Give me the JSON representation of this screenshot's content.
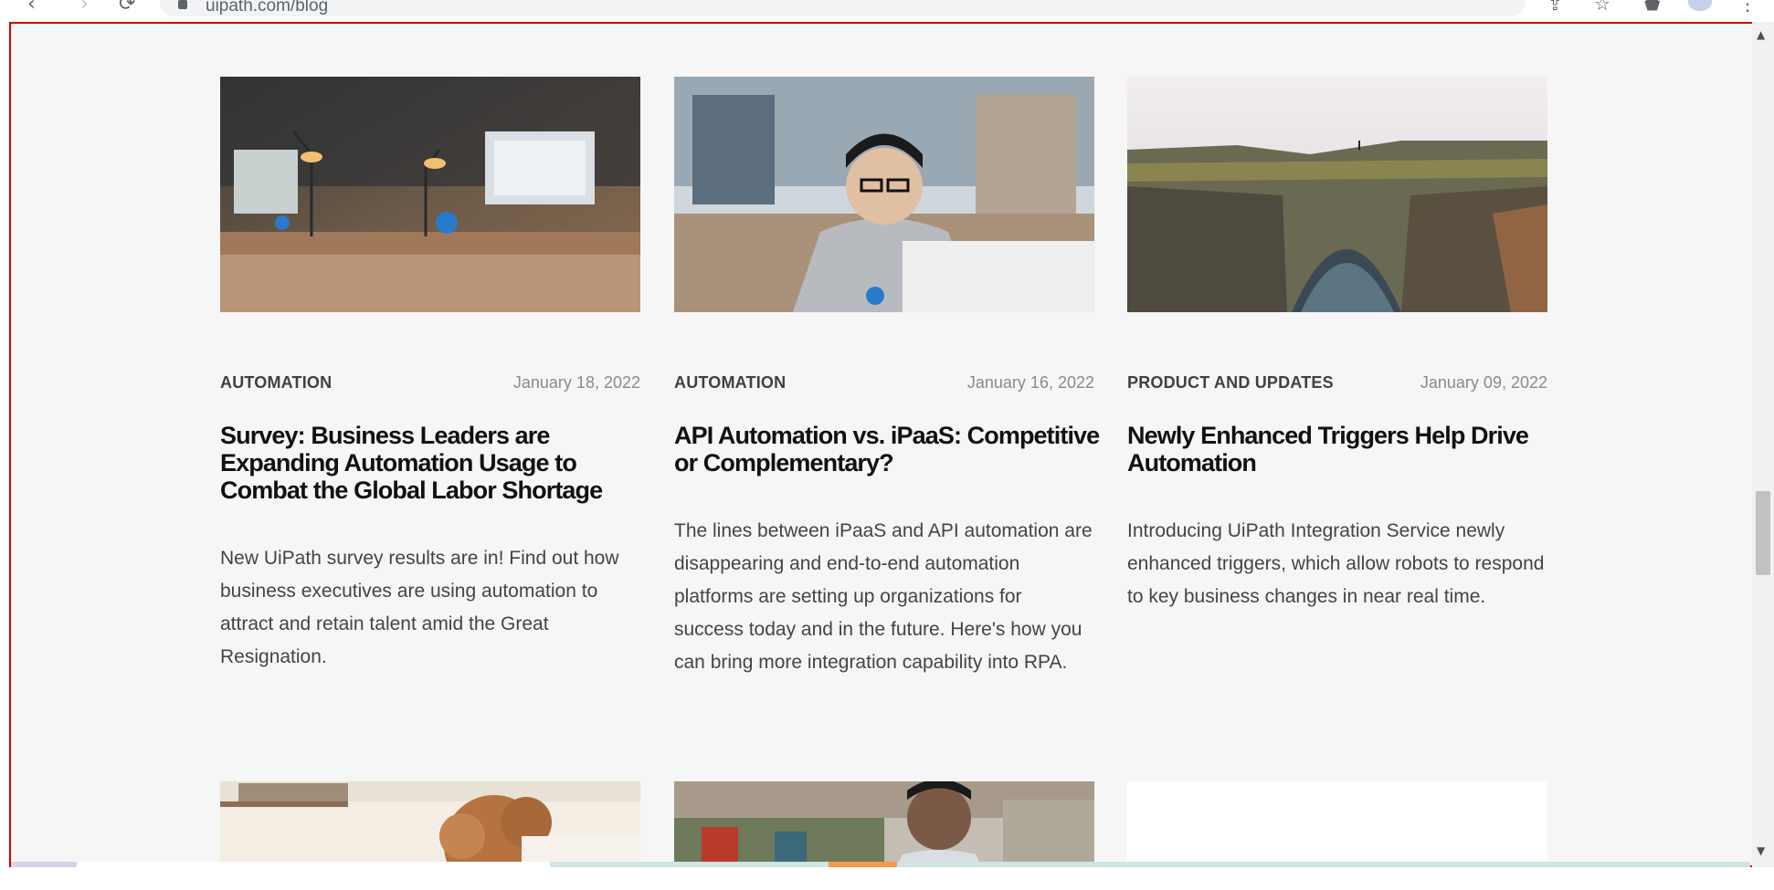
{
  "browser": {
    "url": "uipath.com/blog",
    "back_icon": "‹",
    "forward_icon": "›",
    "reload_icon": "⟳",
    "share_icon": "⇪",
    "star_icon": "☆",
    "extensions_icon": "⬟",
    "menu_icon": "⋮"
  },
  "posts": [
    {
      "category": "AUTOMATION",
      "date": "January 18, 2022",
      "title": "Survey: Business Leaders are Expanding Automation Usage to Combat the Global Labor Shortage",
      "excerpt": "New UiPath survey results are in! Find out how business executives are using automation to attract and retain talent amid the Great Resignation."
    },
    {
      "category": "AUTOMATION",
      "date": "January 16, 2022",
      "title": "API Automation vs. iPaaS: Competitive or Complementary?",
      "excerpt": "The lines between iPaaS and API automation are disappearing and end-to-end automation platforms are setting up organizations for success today and in the future. Here's how you can bring more integration capability into RPA."
    },
    {
      "category": "PRODUCT AND UPDATES",
      "date": "January 09, 2022",
      "title": "Newly Enhanced Triggers Help Drive Automation",
      "excerpt": "Introducing UiPath Integration Service newly enhanced triggers, which allow robots to respond to key business changes in near real time."
    }
  ],
  "scrollbar": {
    "up_arrow": "▲",
    "down_arrow": "▼"
  }
}
